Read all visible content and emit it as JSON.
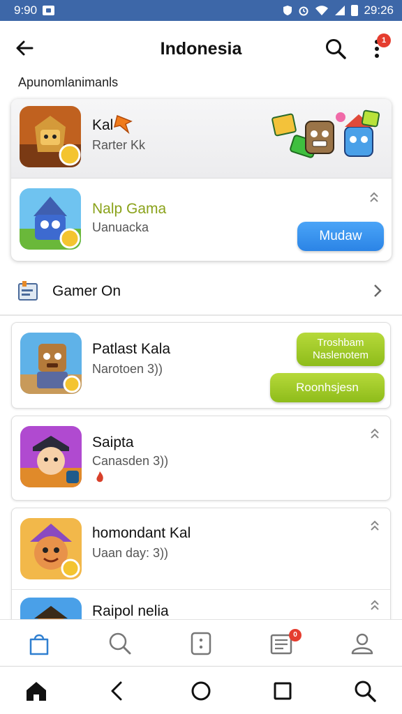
{
  "status_bar": {
    "time_left": "9:90",
    "time_right": "29:26",
    "icons": [
      "screenshot-icon",
      "shield-icon",
      "alarm-icon",
      "wifi-icon",
      "signal-icon",
      "battery-icon"
    ]
  },
  "app_bar": {
    "title": "Indonesia",
    "more_badge": "1",
    "icons": [
      "back-arrow-icon",
      "search-icon",
      "more-vert-icon"
    ]
  },
  "section_label": "Apunomlanimanls",
  "featured": {
    "top": {
      "name": "Kal",
      "subtitle": "Rarter Kk"
    },
    "bottom": {
      "name": "Nalp Gama",
      "subtitle": "Uanuacka",
      "button": "Mudaw"
    },
    "name_color": "#8aa21a",
    "button_color": "#2f8ae8"
  },
  "category": {
    "label": "Gamer On"
  },
  "list": [
    {
      "name": "Patlast Kala",
      "subtitle": "Narotoen 3))",
      "button1": "Troshbam Naslenotem",
      "button2": "Roonhsjesn"
    },
    {
      "name": "Saipta",
      "subtitle": "Canasden 3))"
    },
    {
      "name": "homondant Kal",
      "subtitle": "Uaan day: 3))"
    },
    {
      "name": "Raipol nelia"
    }
  ],
  "bottom_nav": {
    "badge": "0",
    "items": [
      "bag-icon",
      "search-icon",
      "dice-icon",
      "news-icon",
      "profile-icon"
    ],
    "active": "bag-icon",
    "active_color": "#2f7fd0"
  },
  "system_nav": [
    "home-icon",
    "back-icon",
    "circle-home-icon",
    "recents-icon",
    "search-icon"
  ]
}
